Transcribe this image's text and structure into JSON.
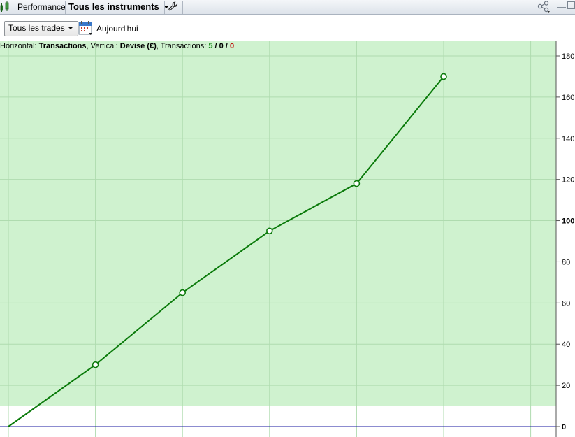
{
  "toolbar": {
    "performance_label": "Performance",
    "instruments_label": "Tous les instruments",
    "icons": [
      "chart-icon",
      "wrench-icon",
      "share-icon",
      "minimize-icon",
      "maximize-icon"
    ]
  },
  "filter": {
    "trades_label": "Tous les trades",
    "date_label": "Aujourd'hui"
  },
  "chart_info": {
    "horizontal_prefix": "Horizontal: ",
    "horizontal_value": "Transactions",
    "vertical_prefix": ", Vertical: ",
    "vertical_value": "Devise (€)",
    "transactions_prefix": ", Transactions: ",
    "count_total": "5",
    "sep1": " / ",
    "count_neutral": "0",
    "sep2": " / ",
    "count_loss": "0"
  },
  "colors": {
    "plot_background": "#cff2cf",
    "line": "#0a7a0a",
    "zero_line": "#1a1aa0",
    "grid": "#afdbaf"
  },
  "chart_data": {
    "type": "line",
    "x": [
      0,
      1,
      2,
      3,
      4,
      5
    ],
    "series": [
      {
        "values": [
          0,
          30,
          65,
          95,
          118,
          170
        ]
      }
    ],
    "ylim": [
      0,
      180
    ],
    "yticks": [
      0,
      20,
      40,
      60,
      80,
      100,
      120,
      140,
      160,
      180
    ],
    "ytick_labels": [
      "0",
      "20",
      "40",
      "60",
      "80",
      "100",
      "120",
      "140",
      "160",
      "180"
    ],
    "bold_ticks": [
      0,
      100
    ],
    "threshold": 10,
    "grid": true
  }
}
